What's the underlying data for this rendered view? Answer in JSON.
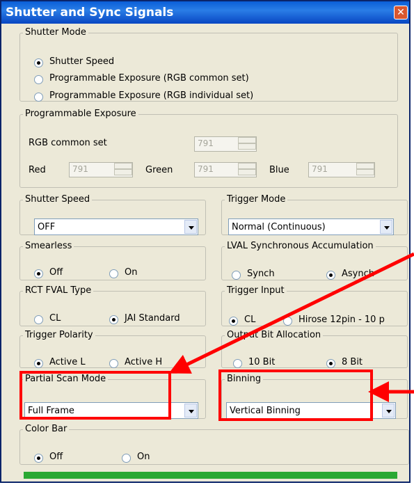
{
  "window": {
    "title": "Shutter and Sync Signals",
    "close_glyph": "✕"
  },
  "shutter_mode": {
    "legend": "Shutter Mode",
    "options": [
      "Shutter Speed",
      "Programmable Exposure (RGB common set)",
      "Programmable Exposure (RGB individual set)"
    ],
    "selected": "Shutter Speed"
  },
  "programmable_exposure": {
    "legend": "Programmable Exposure",
    "common_label": "RGB common set",
    "common_value": "791",
    "red_label": "Red",
    "red_value": "791",
    "green_label": "Green",
    "green_value": "791",
    "blue_label": "Blue",
    "blue_value": "791"
  },
  "shutter_speed": {
    "legend": "Shutter Speed",
    "value": "OFF"
  },
  "trigger_mode": {
    "legend": "Trigger Mode",
    "value": "Normal (Continuous)"
  },
  "smearless": {
    "legend": "Smearless",
    "options": [
      "Off",
      "On"
    ],
    "selected": "Off"
  },
  "lval_sync": {
    "legend": "LVAL Synchronous Accumulation",
    "options": [
      "Synch",
      "Asynch"
    ],
    "selected": "Asynch"
  },
  "rct_fval": {
    "legend": "RCT FVAL Type",
    "options": [
      "CL",
      "JAI Standard"
    ],
    "selected": "JAI Standard"
  },
  "trigger_input": {
    "legend": "Trigger Input",
    "options": [
      "CL",
      "Hirose 12pin - 10 p"
    ],
    "selected": "CL"
  },
  "trigger_polarity": {
    "legend": "Trigger Polarity",
    "options": [
      "Active L",
      "Active H"
    ],
    "selected": "Active L"
  },
  "output_bit": {
    "legend": "Output Bit Allocation",
    "options": [
      "10 Bit",
      "8 Bit"
    ],
    "selected": "8 Bit"
  },
  "partial_scan": {
    "legend": "Partial Scan Mode",
    "value": "Full Frame"
  },
  "binning": {
    "legend": "Binning",
    "value": "Vertical Binning"
  },
  "color_bar": {
    "legend": "Color Bar",
    "options": [
      "Off",
      "On"
    ],
    "selected": "Off"
  },
  "colors": {
    "highlight": "#ff0000",
    "titlebar": "#0a5fd8",
    "progress": "#2aa833"
  }
}
